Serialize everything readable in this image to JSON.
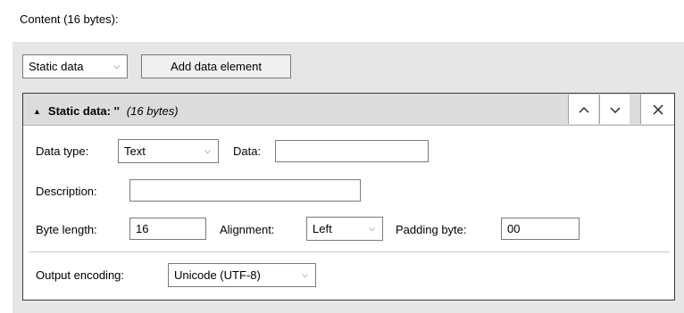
{
  "content_label": "Content (16 bytes):",
  "toolbar": {
    "type_select": "Static data",
    "add_button": "Add data element"
  },
  "element": {
    "title": "Static data: ''",
    "size": "(16 bytes)",
    "controls": {
      "up_icon": "chevron-up-icon",
      "down_icon": "chevron-down-icon",
      "close_icon": "close-icon"
    },
    "data_type": {
      "label": "Data type:",
      "value": "Text"
    },
    "data": {
      "label": "Data:",
      "value": ""
    },
    "description": {
      "label": "Description:",
      "value": ""
    },
    "byte_length": {
      "label": "Byte length:",
      "value": "16"
    },
    "alignment": {
      "label": "Alignment:",
      "value": "Left"
    },
    "padding_byte": {
      "label": "Padding byte:",
      "value": "00"
    },
    "output_encoding": {
      "label": "Output encoding:",
      "value": "Unicode (UTF-8)"
    }
  },
  "colors": {
    "panel_bg": "#e6e6e6",
    "header_bg": "#dcdcdc",
    "border": "#3a3a3a"
  }
}
